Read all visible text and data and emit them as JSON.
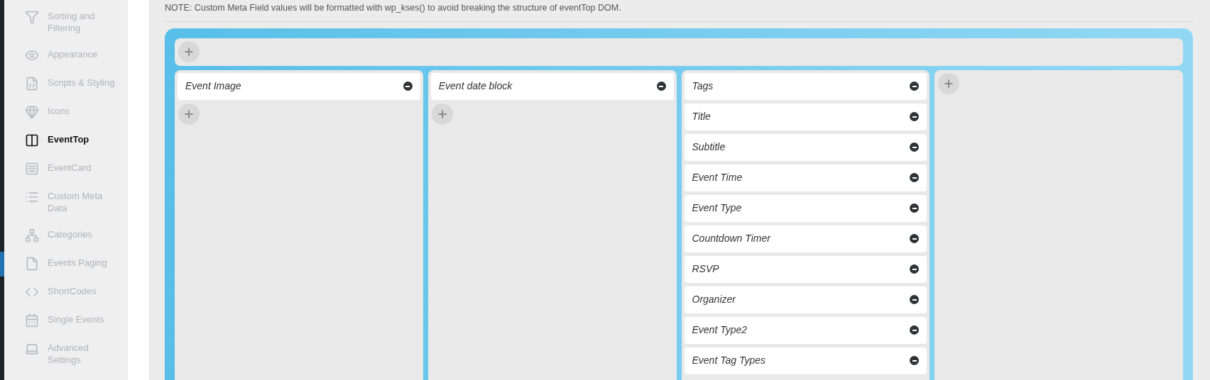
{
  "sidebar": {
    "items": [
      {
        "label": "Sorting and Filtering",
        "selected": false
      },
      {
        "label": "Appearance",
        "selected": false
      },
      {
        "label": "Scripts & Styling",
        "selected": false
      },
      {
        "label": "Icons",
        "selected": false
      },
      {
        "label": "EventTop",
        "selected": true
      },
      {
        "label": "EventCard",
        "selected": false
      },
      {
        "label": "Custom Meta Data",
        "selected": false
      },
      {
        "label": "Categories",
        "selected": false
      },
      {
        "label": "Events Paging",
        "selected": false
      },
      {
        "label": "ShortCodes",
        "selected": false
      },
      {
        "label": "Single Events",
        "selected": false
      },
      {
        "label": "Advanced Settings",
        "selected": false
      }
    ]
  },
  "note": "NOTE: Custom Meta Field values will be formatted with wp_kses() to avoid breaking the structure of eventTop DOM.",
  "layout": {
    "top_row": {
      "add_button": true
    },
    "columns": [
      {
        "items": [
          "Event Image"
        ],
        "add_button": true
      },
      {
        "items": [
          "Event date block"
        ],
        "add_button": true
      },
      {
        "items": [
          "Tags",
          "Title",
          "Subtitle",
          "Event Time",
          "Event Type",
          "Countdown Timer",
          "RSVP",
          "Organizer",
          "Event Type2",
          "Event Tag Types"
        ],
        "add_button": false
      },
      {
        "add_button": true
      }
    ]
  }
}
